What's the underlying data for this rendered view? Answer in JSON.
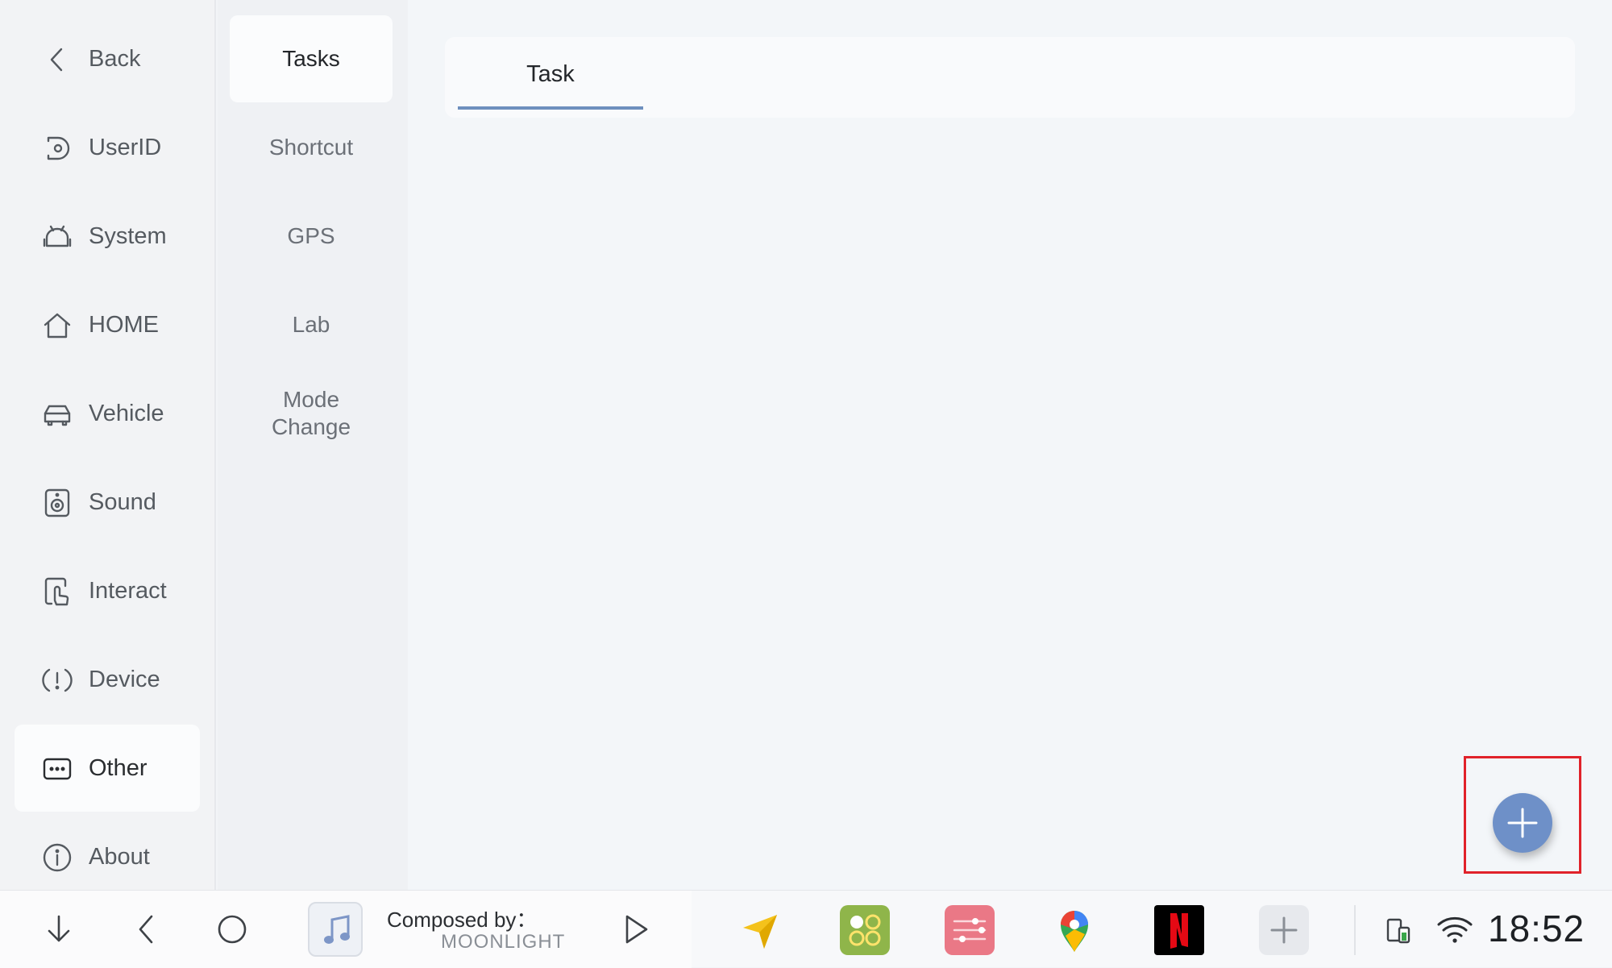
{
  "sidebar": {
    "items": [
      {
        "label": "Back",
        "icon": "chevron-left-icon"
      },
      {
        "label": "UserID",
        "icon": "user-id-icon"
      },
      {
        "label": "System",
        "icon": "android-icon"
      },
      {
        "label": "HOME",
        "icon": "home-icon"
      },
      {
        "label": "Vehicle",
        "icon": "car-icon"
      },
      {
        "label": "Sound",
        "icon": "speaker-icon"
      },
      {
        "label": "Interact",
        "icon": "touch-icon"
      },
      {
        "label": "Device",
        "icon": "alert-icon"
      },
      {
        "label": "Other",
        "icon": "more-icon",
        "active": true
      },
      {
        "label": "About",
        "icon": "info-icon"
      }
    ]
  },
  "subnav": {
    "items": [
      {
        "label": "Tasks",
        "active": true
      },
      {
        "label": "Shortcut"
      },
      {
        "label": "GPS"
      },
      {
        "label": "Lab"
      },
      {
        "label": "Mode\nChange"
      }
    ]
  },
  "main": {
    "tabs": [
      {
        "label": "Task",
        "active": true
      }
    ],
    "fab_icon": "plus-icon"
  },
  "bottom_bar": {
    "nav": [
      "arrow-down-icon",
      "back-icon",
      "home-circle-icon"
    ],
    "music": {
      "title": "Composed by：",
      "artist": "MOONLIGHT",
      "thumb_icon": "music-note-icon"
    },
    "dock_apps": [
      "navigation-app",
      "apps-grid-app",
      "equalizer-app",
      "google-maps-app",
      "netflix-app",
      "add-app"
    ],
    "status": {
      "time": "18:52",
      "icons": [
        "phone-battery-icon",
        "wifi-icon"
      ]
    }
  },
  "colors": {
    "accent": "#6e8fbe",
    "fab": "#6e90c8",
    "highlight": "#e0222a",
    "netflix": "#e50914"
  }
}
